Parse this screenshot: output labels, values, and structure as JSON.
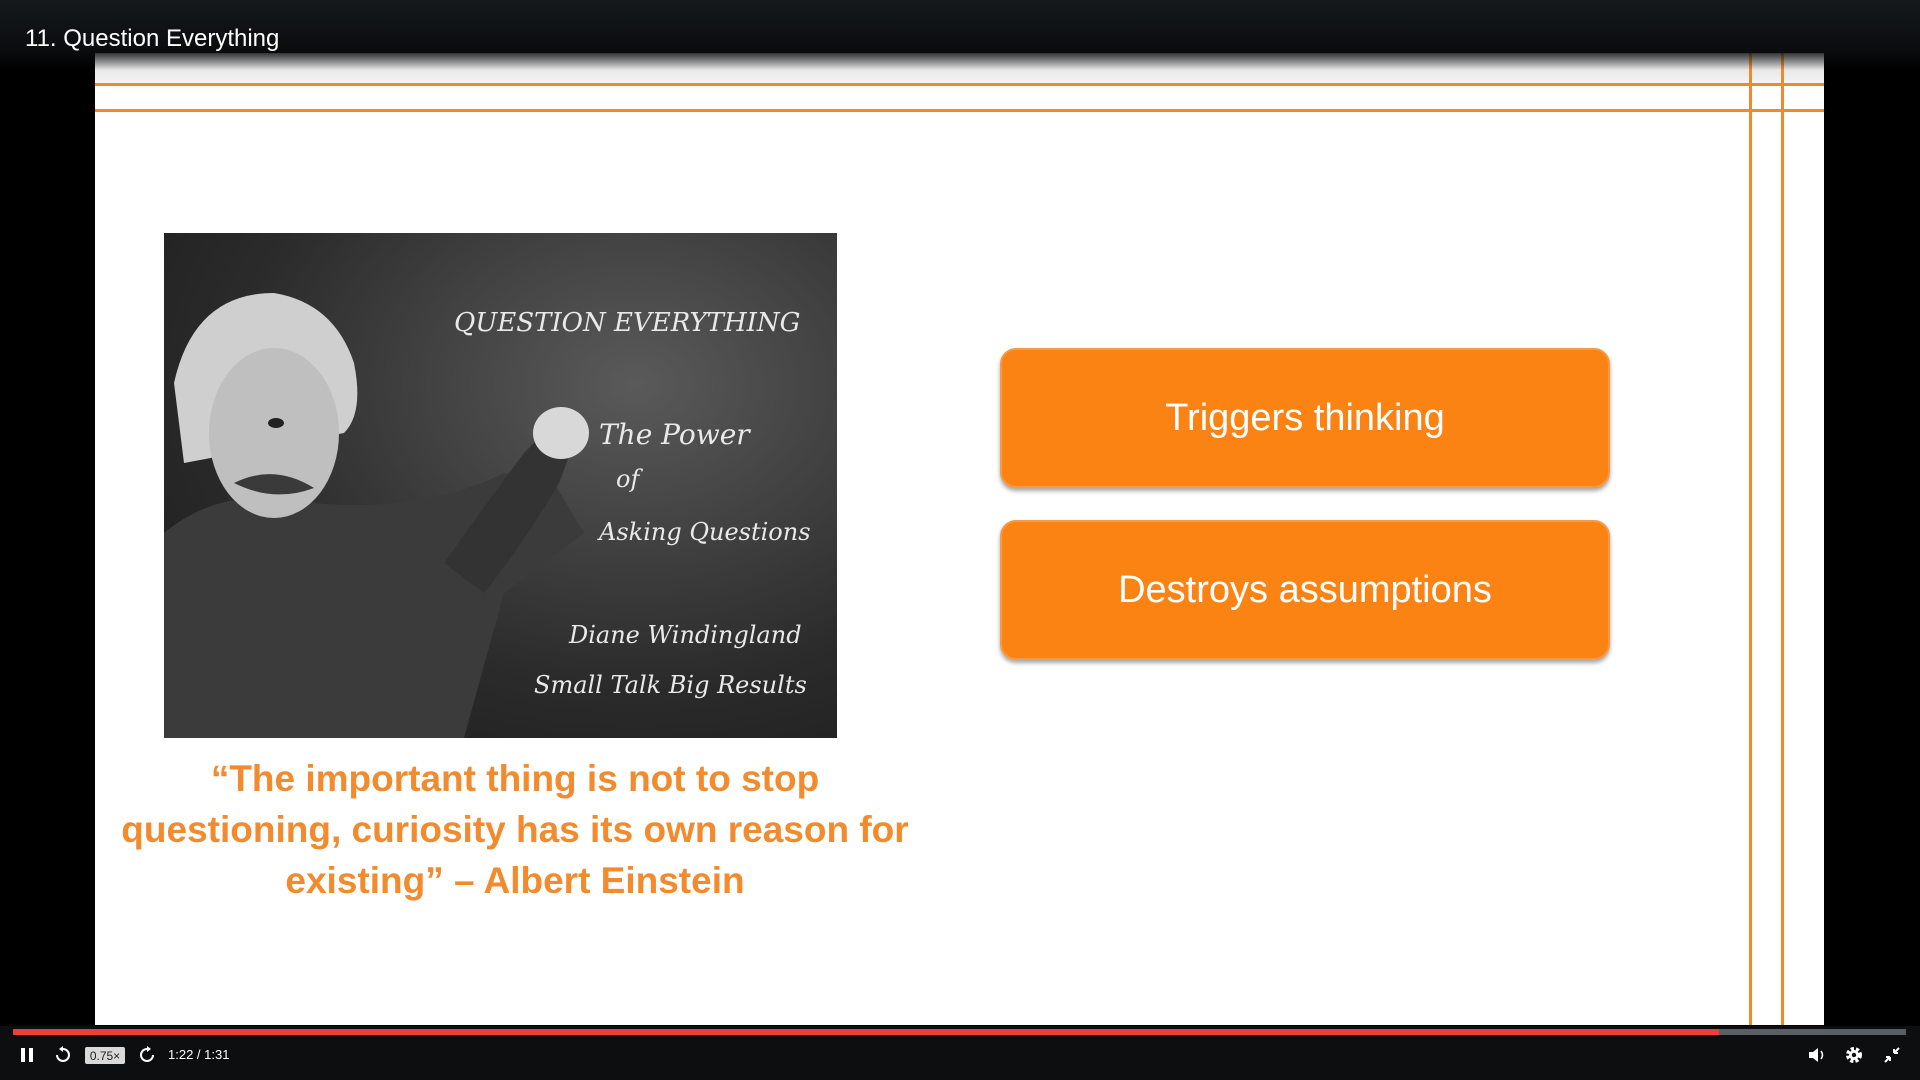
{
  "player": {
    "title": "11. Question Everything",
    "speed": "0.75×",
    "time": "1:22 / 1:31",
    "progress_percent": 90.1,
    "accent_color": "#ec3f3a"
  },
  "slide": {
    "accent_color": "#f0892c",
    "box_color": "#fb8313",
    "image": {
      "chalk_title": "QUESTION EVERYTHING",
      "chalk_line1": "The Power",
      "chalk_line2": "of",
      "chalk_line3": "Asking Questions",
      "chalk_line4": "Diane Windingland",
      "chalk_line5": "Small Talk Big Results"
    },
    "quote": "“The important thing is not to stop questioning, curiosity has its own reason for existing” – Albert Einstein",
    "boxes": [
      {
        "label": "Triggers thinking"
      },
      {
        "label": "Destroys assumptions"
      }
    ]
  },
  "icons": {
    "play_pause": "pause-icon",
    "rewind": "rewind-icon",
    "forward": "forward-icon",
    "volume": "volume-icon",
    "settings": "gear-icon",
    "fullscreen": "exit-fullscreen-icon"
  }
}
